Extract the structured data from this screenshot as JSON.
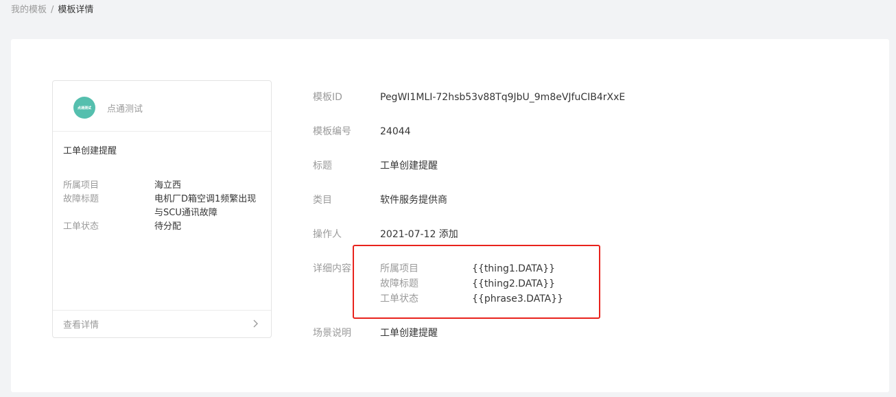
{
  "breadcrumb": {
    "parent": "我的模板",
    "separator": "/",
    "current": "模板详情"
  },
  "preview": {
    "avatar_text": "点通测试",
    "account_name": "点通测试",
    "title": "工单创建提醒",
    "fields": [
      {
        "key": "所属项目",
        "value": "海立西"
      },
      {
        "key": "故障标题",
        "value": "电机厂D箱空调1频繁出现与SCU通讯故障"
      },
      {
        "key": "工单状态",
        "value": "待分配"
      }
    ],
    "view_details_label": "查看详情"
  },
  "detail": {
    "template_id_label": "模板ID",
    "template_id": "PegWI1MLI-72hsb53v88Tq9JbU_9m8eVJfuCIB4rXxE",
    "template_no_label": "模板编号",
    "template_no": "24044",
    "title_label": "标题",
    "title": "工单创建提醒",
    "category_label": "类目",
    "category": "软件服务提供商",
    "operator_label": "操作人",
    "operator": "2021-07-12 添加",
    "content_label": "详细内容",
    "content": [
      {
        "key": "所属项目",
        "value": "{{thing1.DATA}}"
      },
      {
        "key": "故障标题",
        "value": "{{thing2.DATA}}"
      },
      {
        "key": "工单状态",
        "value": "{{phrase3.DATA}}"
      }
    ],
    "scene_label": "场景说明",
    "scene": "工单创建提醒"
  },
  "colors": {
    "accent_avatar": "#55bfae",
    "highlight_border": "#e8221c"
  }
}
